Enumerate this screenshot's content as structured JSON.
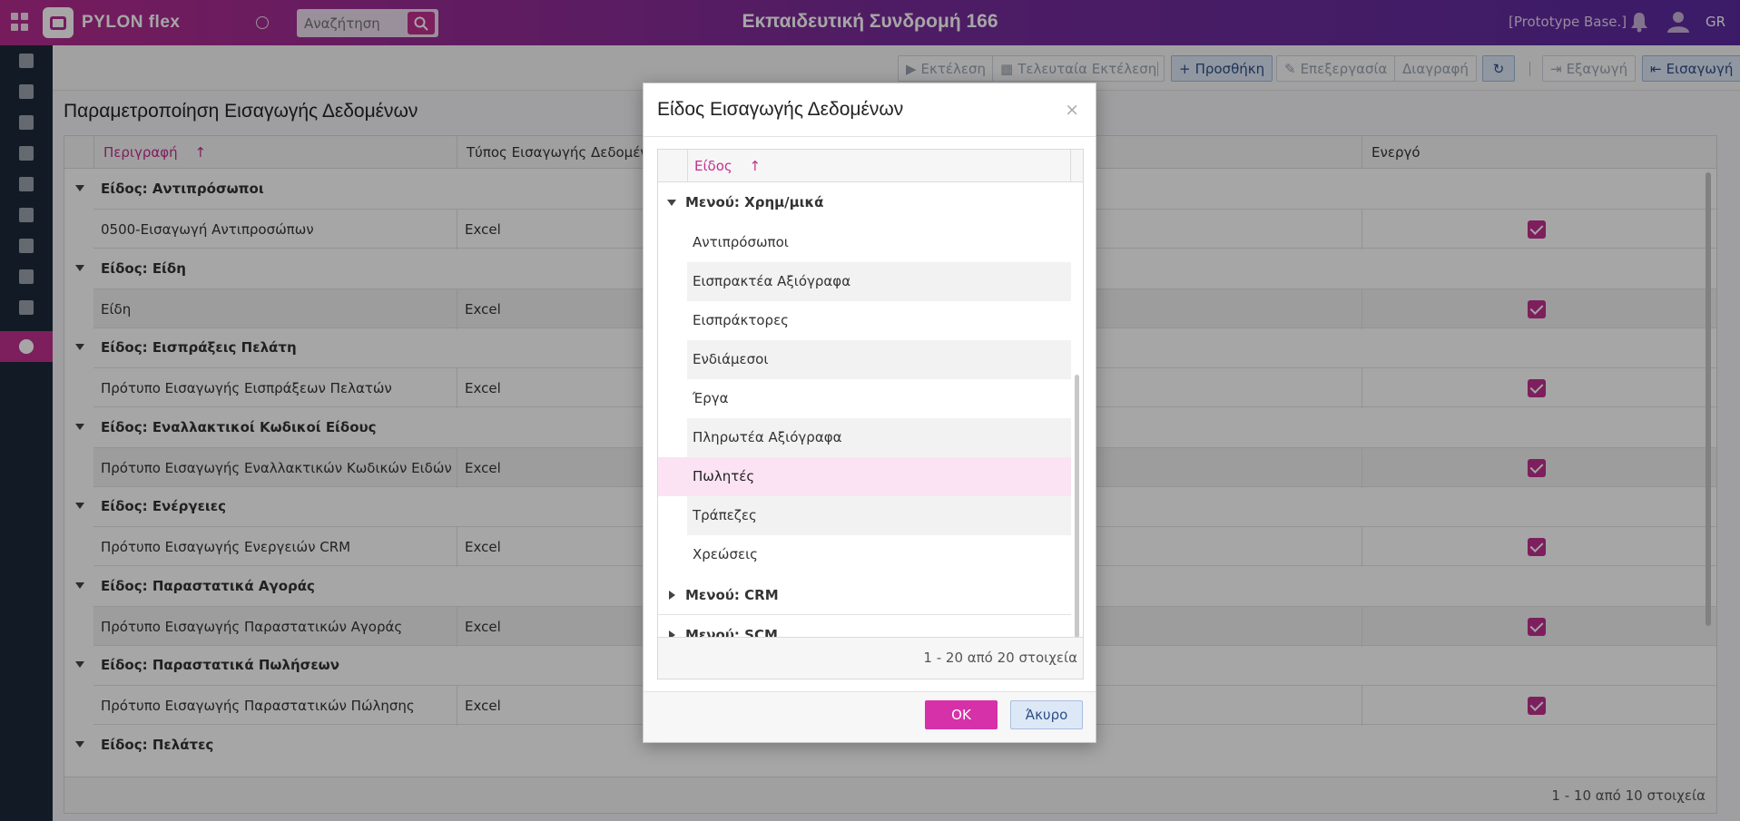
{
  "topbar": {
    "logo": "PYLON flex",
    "search_placeholder": "Αναζήτηση",
    "title": "Εκπαιδευτική Συνδρομή 166",
    "db_label": "[Prototype Base.]",
    "lang": "GR"
  },
  "toolbar": {
    "run": "Εκτέλεση",
    "last_run": "Τελευταία Εκτέλεση",
    "add": "Προσθήκη",
    "edit": "Επεξεργασία",
    "delete": "Διαγραφή",
    "export": "Εξαγωγή",
    "import": "Εισαγωγή"
  },
  "main": {
    "title": "Παραμετροποίηση Εισαγωγής Δεδομένων",
    "columns": [
      "Περιγραφή",
      "Τύπος Εισαγωγής Δεδομένων",
      "Ενεργό"
    ],
    "groups": [
      {
        "label": "Είδος: Αντιπρόσωποι",
        "row": "0500-Εισαγωγή Αντιπροσώπων",
        "type": "Excel"
      },
      {
        "label": "Είδος: Είδη",
        "row": "Είδη",
        "type": "Excel"
      },
      {
        "label": "Είδος: Εισπράξεις Πελάτη",
        "row": "Πρότυπο Εισαγωγής Εισπράξεων Πελατών",
        "type": "Excel"
      },
      {
        "label": "Είδος: Εναλλακτικοί Κωδικοί Είδους",
        "row": "Πρότυπο Εισαγωγής Εναλλακτικών Κωδικών Ειδών",
        "type": "Excel"
      },
      {
        "label": "Είδος: Ενέργειες",
        "row": "Πρότυπο Εισαγωγής Ενεργειών CRM",
        "type": "Excel"
      },
      {
        "label": "Είδος: Παραστατικά Αγοράς",
        "row": "Πρότυπο Εισαγωγής Παραστατικών Αγοράς",
        "type": "Excel"
      },
      {
        "label": "Είδος: Παραστατικά Πωλήσεων",
        "row": "Πρότυπο Εισαγωγής Παραστατικών Πώλησης",
        "type": "Excel"
      },
      {
        "label": "Είδος: Πελάτες",
        "row": "",
        "type": ""
      }
    ],
    "footer": "1 - 10 από 10 στοιχεία"
  },
  "modal": {
    "title": "Είδος Εισαγωγής Δεδομένων",
    "close": "×",
    "column": "Είδος",
    "group1": "Μενού: Χρημ/μικά",
    "items": [
      "Αντιπρόσωποι",
      "Εισπρακτέα Αξιόγραφα",
      "Εισπράκτορες",
      "Ενδιάμεσοι",
      "Έργα",
      "Πληρωτέα Αξιόγραφα",
      "Πωλητές",
      "Τράπεζες",
      "Χρεώσεις"
    ],
    "selected_index": 6,
    "group2": "Μενού: CRM",
    "group3": "Μενού: SCM",
    "footer": "1 - 20 από 20 στοιχεία",
    "ok": "OK",
    "cancel": "Άκυρο"
  },
  "colors": {
    "accent": "#c1308f",
    "topbar_start": "#b52c8f",
    "topbar_end": "#5b2aa0",
    "sidebar": "#1d2a3a"
  }
}
